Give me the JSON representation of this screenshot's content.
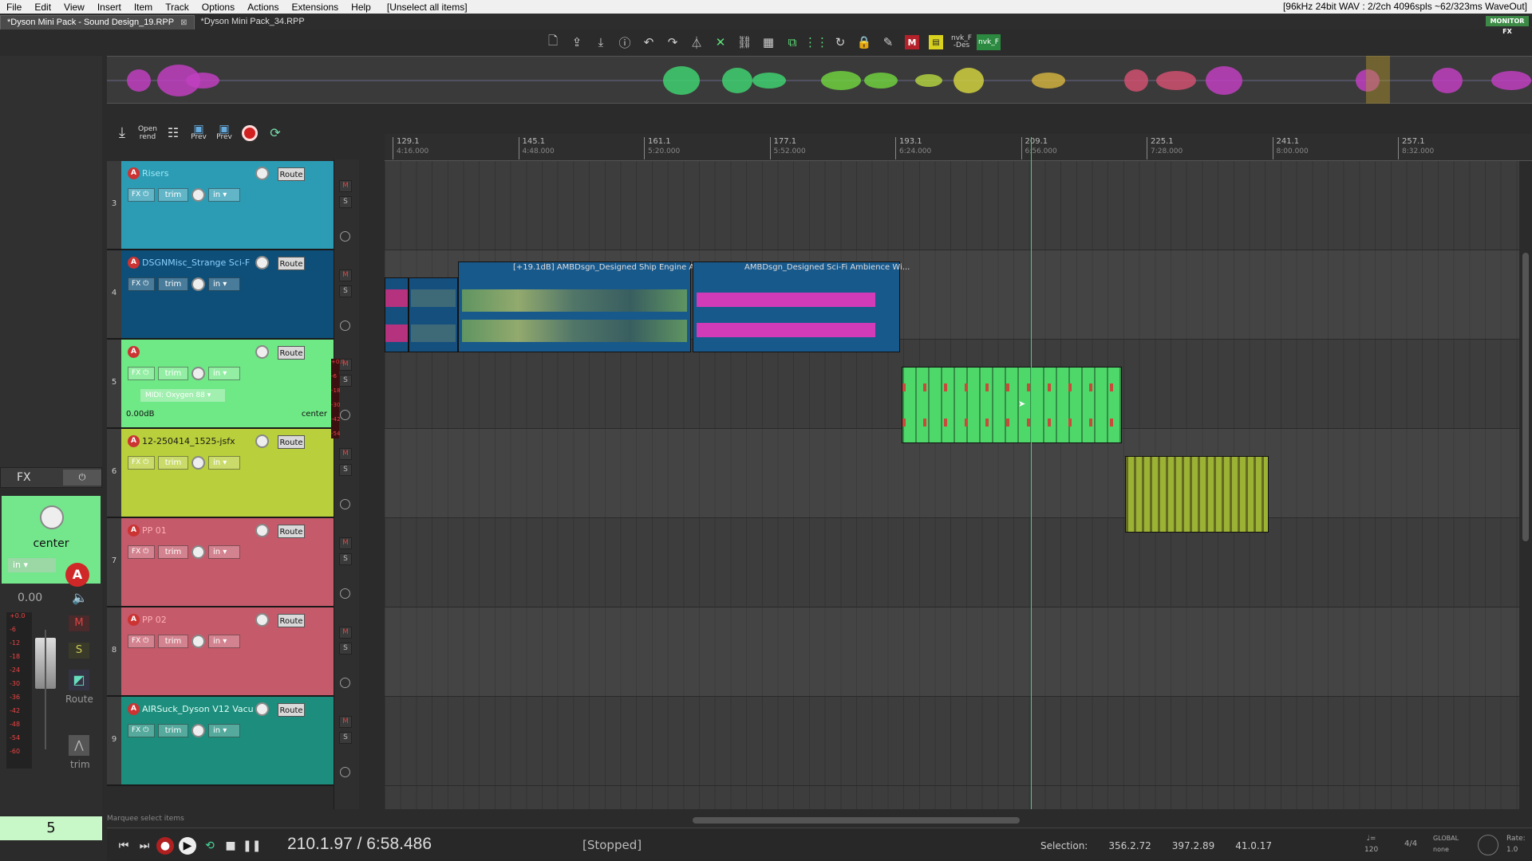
{
  "menubar": {
    "items": [
      "File",
      "Edit",
      "View",
      "Insert",
      "Item",
      "Track",
      "Options",
      "Actions",
      "Extensions",
      "Help"
    ],
    "unselect_label": "[Unselect all items]",
    "audio_status": "[96kHz 24bit WAV : 2/2ch 4096spls ~62/323ms WaveOut]"
  },
  "tabs": [
    {
      "label": "*Dyson Mini Pack - Sound Design_19.RPP",
      "active": true,
      "close": "⊠"
    },
    {
      "label": "*Dyson Mini Pack_34.RPP",
      "active": false
    }
  ],
  "monitor_fx": "MONITOR FX",
  "toolbar": {
    "nvk_des": "nvk_F -Des",
    "nvk_f": "nvk_F",
    "m_label": "M"
  },
  "panel_toolbar": {
    "open_rend": "Open rend",
    "prev1": "Prev",
    "prev2": "Prev"
  },
  "ruler": [
    {
      "bar": "129.1",
      "time": "4:16.000"
    },
    {
      "bar": "145.1",
      "time": "4:48.000"
    },
    {
      "bar": "161.1",
      "time": "5:20.000"
    },
    {
      "bar": "177.1",
      "time": "5:52.000"
    },
    {
      "bar": "193.1",
      "time": "6:24.000"
    },
    {
      "bar": "209.1",
      "time": "6:56.000"
    },
    {
      "bar": "225.1",
      "time": "7:28.000"
    },
    {
      "bar": "241.1",
      "time": "8:00.000"
    },
    {
      "bar": "257.1",
      "time": "8:32.000"
    }
  ],
  "tracks": [
    {
      "num": "3",
      "name": "Risers",
      "color": "#2c9cb4",
      "name_color": "#9fe8f6",
      "route": "Route"
    },
    {
      "num": "4",
      "name": "DSGNMisc_Strange Sci-F",
      "color": "#0d4f78",
      "name_color": "#8ccfff",
      "route": "Route"
    },
    {
      "num": "5",
      "name": "",
      "color": "#6fe886",
      "name_color": "#111",
      "route": "Route",
      "midi": "MIDI: Oxygen 88",
      "volume": "0.00dB",
      "pan": "center"
    },
    {
      "num": "6",
      "name": "12-250414_1525-jsfx",
      "color": "#b9cf3b",
      "name_color": "#1a1a1a",
      "route": "Route"
    },
    {
      "num": "7",
      "name": "PP 01",
      "color": "#c55a6a",
      "name_color": "#ffb0b8",
      "route": "Route"
    },
    {
      "num": "8",
      "name": "PP 02",
      "color": "#c55a6a",
      "name_color": "#ffb0b8",
      "route": "Route"
    },
    {
      "num": "9",
      "name": "AIRSuck_Dyson V12 Vacu",
      "color": "#1d8d7d",
      "name_color": "#e0fff7",
      "route": "Route"
    }
  ],
  "track_controls": {
    "fx": "FX",
    "trim": "trim",
    "in": "in"
  },
  "meter_scale": [
    "+0.0",
    "-6",
    "-18",
    "-30",
    "-42",
    "-54"
  ],
  "items": {
    "item2_label": "[+19.1dB] AMBDsgn_Designed Ship Engine Am...",
    "item3_label": "AMBDsgn_Designed Sci-Fi Ambience Wi..."
  },
  "mixer": {
    "fx": "FX",
    "pan": "center",
    "in": "in",
    "volume": "0.00",
    "scale": [
      "+0.0",
      "-6",
      "-12",
      "-18",
      "-24",
      "-30",
      "-36",
      "-42",
      "-48",
      "-54",
      "-60"
    ],
    "m": "M",
    "s": "S",
    "route": "Route",
    "trim": "trim",
    "track_num": "5"
  },
  "status_message": "Marquee select items",
  "transport": {
    "position": "210.1.97 / 6:58.486",
    "state": "[Stopped]",
    "selection_label": "Selection:",
    "sel_start": "356.2.72",
    "sel_end": "397.2.89",
    "sel_len": "41.0.17",
    "bpm_label": "♩=",
    "bpm": "120",
    "timesig": "4/4",
    "global": "GLOBAL",
    "none": "none",
    "rate_label": "Rate:",
    "rate": "1.0"
  }
}
